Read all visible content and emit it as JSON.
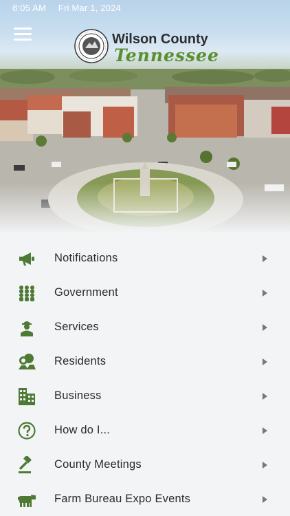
{
  "status_bar": {
    "time": "8:05 AM",
    "date": "Fri Mar 1, 2024"
  },
  "header": {
    "title": "Wilson County",
    "subtitle": "Tennessee"
  },
  "colors": {
    "accent": "#5a8f2e",
    "icon": "#4e7a36",
    "background": "#f3f4f5"
  },
  "menu": [
    {
      "label": "Notifications",
      "icon": "megaphone-icon"
    },
    {
      "label": "Government",
      "icon": "people-group-icon"
    },
    {
      "label": "Services",
      "icon": "worker-icon"
    },
    {
      "label": "Residents",
      "icon": "residents-icon"
    },
    {
      "label": "Business",
      "icon": "building-icon"
    },
    {
      "label": "How do I...",
      "icon": "question-icon"
    },
    {
      "label": "County Meetings",
      "icon": "gavel-icon"
    },
    {
      "label": "Farm Bureau Expo Events",
      "icon": "cow-icon"
    }
  ]
}
